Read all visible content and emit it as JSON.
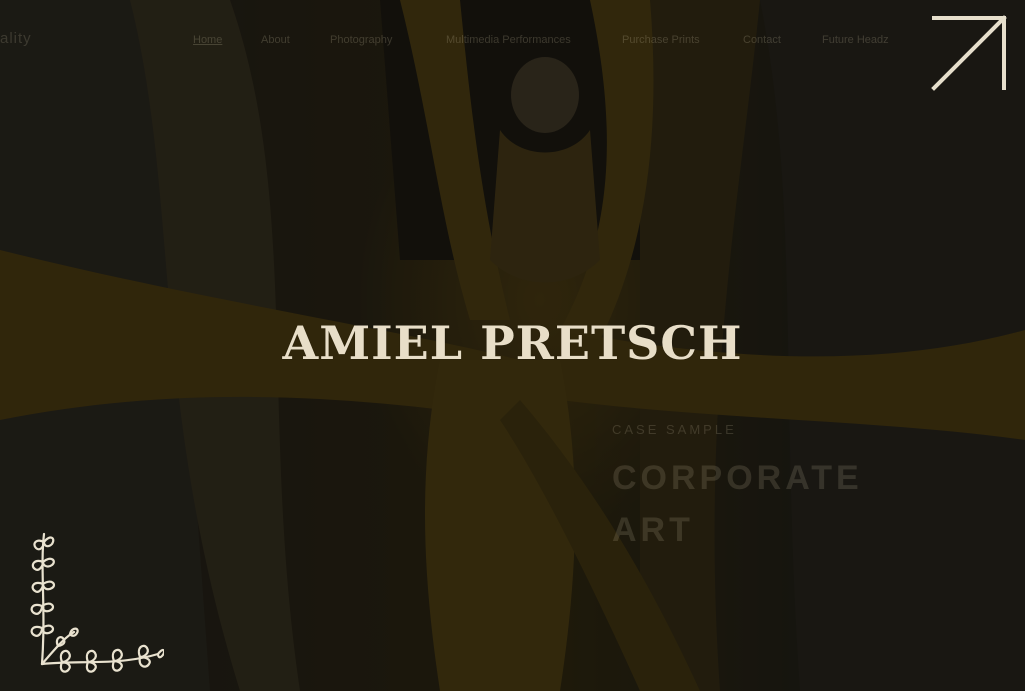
{
  "brand": {
    "text": "ality"
  },
  "nav": {
    "items": [
      {
        "label": "Home"
      },
      {
        "label": "About"
      },
      {
        "label": "Photography"
      },
      {
        "label": "Multimedia Performances"
      },
      {
        "label": "Purchase Prints"
      },
      {
        "label": "Contact"
      },
      {
        "label": "Future Headz"
      }
    ]
  },
  "hero": {
    "title": "AMIEL PRETSCH"
  },
  "case": {
    "kicker": "CASE SAMPLE",
    "title_line1": "CORPORATE",
    "title_line2": "ART"
  },
  "colors": {
    "title": "#e8dec8",
    "ornament": "#e9e2cf",
    "overlay": "#0e0c08"
  },
  "icons": {
    "expand": "arrow-up-right-icon",
    "ornament": "leaf-corner-ornament"
  }
}
